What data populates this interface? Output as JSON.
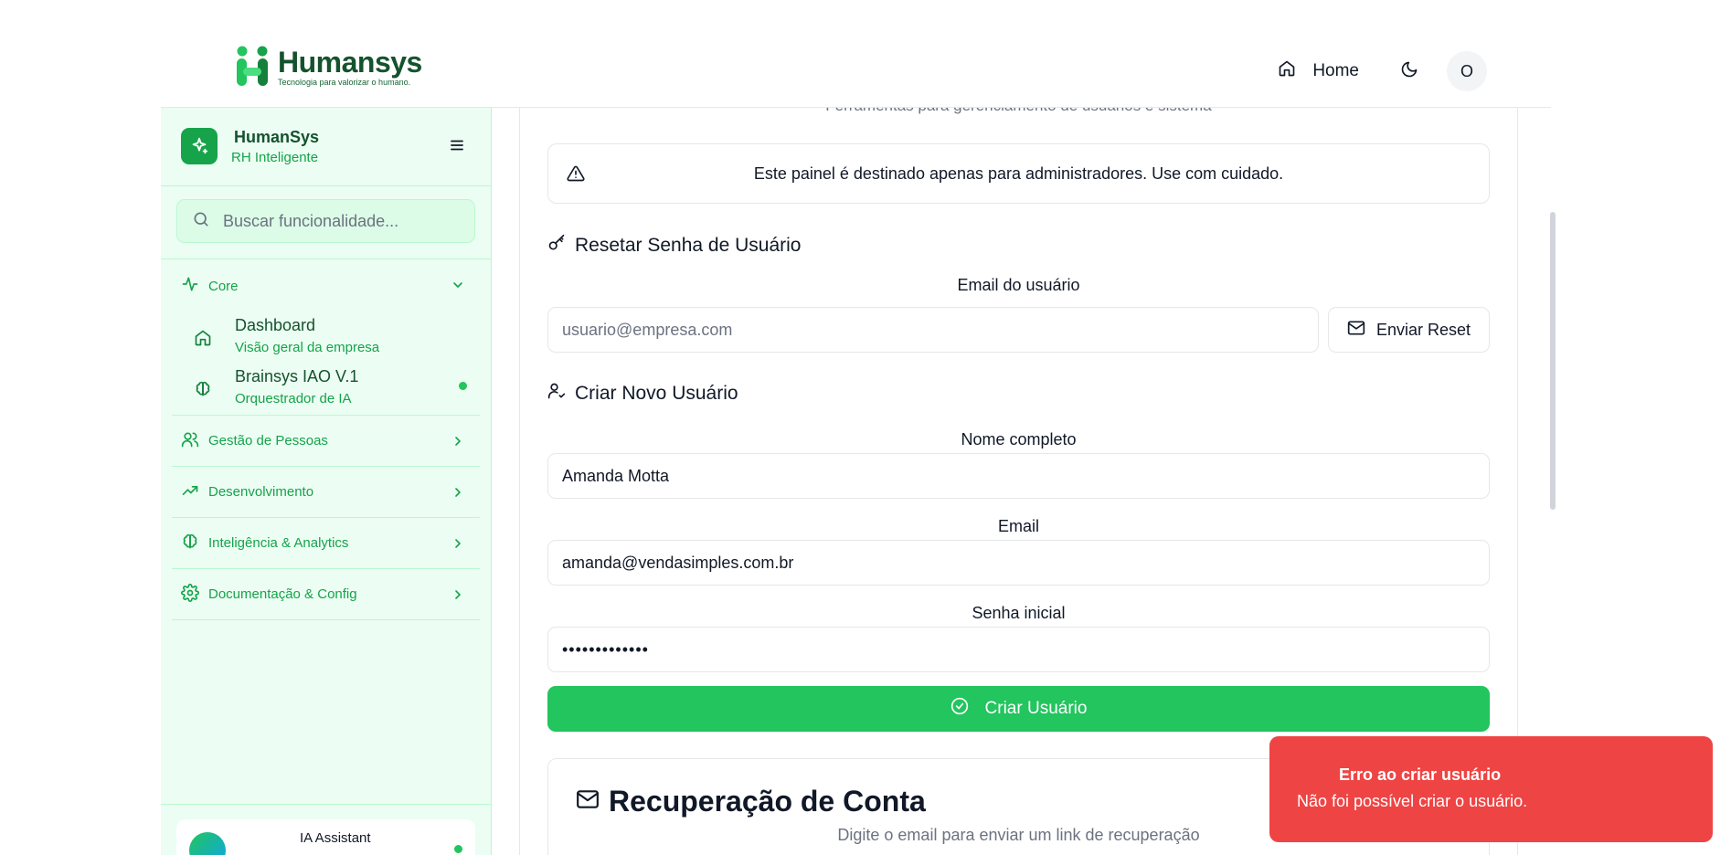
{
  "header": {
    "logo_title": "Humansys",
    "logo_tagline": "Tecnologia para valorizar o humano.",
    "home_label": "Home",
    "avatar_initial": "O"
  },
  "sidebar": {
    "brand_title": "HumanSys",
    "brand_subtitle": "RH Inteligente",
    "search_placeholder": "Buscar funcionalidade...",
    "core": {
      "label": "Core",
      "items": [
        {
          "title": "Dashboard",
          "subtitle": "Visão geral da empresa",
          "icon": "home-icon"
        },
        {
          "title": "Brainsys IAO V.1",
          "subtitle": "Orquestrador de IA",
          "icon": "brain-icon"
        }
      ]
    },
    "groups": [
      {
        "label": "Gestão de Pessoas",
        "icon": "users-icon"
      },
      {
        "label": "Desenvolvimento",
        "icon": "trending-up-icon"
      },
      {
        "label": "Inteligência & Analytics",
        "icon": "brain-icon"
      },
      {
        "label": "Documentação & Config",
        "icon": "gear-icon"
      }
    ],
    "assistant_label": "IA Assistant"
  },
  "main": {
    "cut_subtitle": "Ferramentas para gerenciamento de usuários e sistema",
    "alert_text": "Este painel é destinado apenas para administradores. Use com cuidado.",
    "reset": {
      "title": "Resetar Senha de Usuário",
      "email_label": "Email do usuário",
      "email_placeholder": "usuario@empresa.com",
      "button": "Enviar Reset"
    },
    "create": {
      "title": "Criar Novo Usuário",
      "name_label": "Nome completo",
      "name_value": "Amanda Motta",
      "email_label": "Email",
      "email_value": "amanda@vendasimples.com.br",
      "password_label": "Senha inicial",
      "password_value": "•••••••••••••",
      "button": "Criar Usuário"
    },
    "recovery": {
      "title": "Recuperação de Conta",
      "subtitle": "Digite o email para enviar um link de recuperação"
    }
  },
  "toast": {
    "title": "Erro ao criar usuário",
    "message": "Não foi possível criar o usuário."
  },
  "colors": {
    "accent": "#22c55e",
    "brand_dark": "#14532d",
    "sidebar_bg": "#ecfdf3",
    "error": "#ef4444"
  }
}
